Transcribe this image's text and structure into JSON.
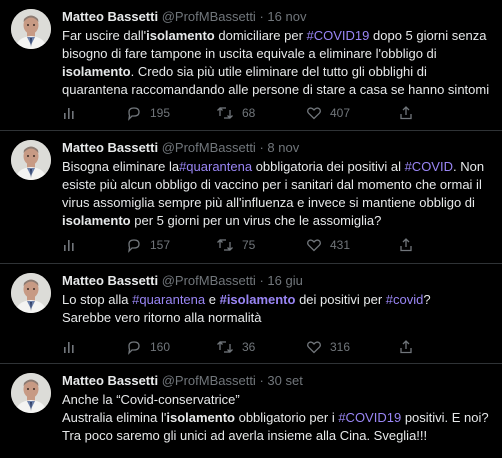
{
  "colors": {
    "background": "#000000",
    "text": "#e7e9ea",
    "muted": "#71767b",
    "hashtag": "#9a86f5",
    "divider": "#2f3336"
  },
  "tweets": [
    {
      "name": "Matteo Bassetti",
      "handle": "@ProfMBassetti",
      "sep": "·",
      "date": "16 nov",
      "parts": [
        {
          "t": "Far uscire dall'",
          "s": "text"
        },
        {
          "t": "isolamento",
          "s": "bold"
        },
        {
          "t": " domiciliare per ",
          "s": "text"
        },
        {
          "t": "#COVID19",
          "s": "tag"
        },
        {
          "t": " dopo 5 giorni senza bisogno di fare tampone in uscita equivale a eliminare l'obbligo di ",
          "s": "text"
        },
        {
          "t": "isolamento",
          "s": "bold"
        },
        {
          "t": ". Credo sia più utile eliminare del tutto gli obblighi di quarantena raccomandando alle persone di stare a casa se hanno sintomi",
          "s": "text"
        }
      ],
      "stats": {
        "views": "",
        "replies": "195",
        "retweets": "68",
        "likes": "407"
      }
    },
    {
      "name": "Matteo Bassetti",
      "handle": "@ProfMBassetti",
      "sep": "·",
      "date": "8 nov",
      "parts": [
        {
          "t": "Bisogna eliminare la",
          "s": "text"
        },
        {
          "t": "#quarantena",
          "s": "tag"
        },
        {
          "t": " obbligatoria dei positivi al ",
          "s": "text"
        },
        {
          "t": "#COVID",
          "s": "tag"
        },
        {
          "t": ". Non esiste più alcun obbligo di vaccino per i sanitari dal momento che ormai il virus assomiglia sempre più all'influenza e invece si mantiene obbligo di ",
          "s": "text"
        },
        {
          "t": "isolamento",
          "s": "bold"
        },
        {
          "t": " per 5 giorni per un virus che le assomiglia?",
          "s": "text"
        }
      ],
      "stats": {
        "views": "",
        "replies": "157",
        "retweets": "75",
        "likes": "431"
      }
    },
    {
      "name": "Matteo Bassetti",
      "handle": "@ProfMBassetti",
      "sep": "·",
      "date": "16 giu",
      "parts": [
        {
          "t": "Lo stop alla ",
          "s": "text"
        },
        {
          "t": "#quarantena",
          "s": "tag"
        },
        {
          "t": " e ",
          "s": "text"
        },
        {
          "t": "#isolamento",
          "s": "tagbold"
        },
        {
          "t": " dei positivi per ",
          "s": "text"
        },
        {
          "t": "#covid",
          "s": "tag"
        },
        {
          "t": "?",
          "s": "text"
        },
        {
          "t": "\n",
          "s": "br"
        },
        {
          "t": "Sarebbe vero ritorno alla normalità",
          "s": "text"
        }
      ],
      "stats": {
        "views": "",
        "replies": "160",
        "retweets": "36",
        "likes": "316"
      }
    },
    {
      "name": "Matteo Bassetti",
      "handle": "@ProfMBassetti",
      "sep": "·",
      "date": "30 set",
      "parts": [
        {
          "t": "Anche la “Covid-conservatrice”",
          "s": "text"
        },
        {
          "t": "\n",
          "s": "br"
        },
        {
          "t": "Australia elimina l'",
          "s": "text"
        },
        {
          "t": "isolamento",
          "s": "bold"
        },
        {
          "t": " obbligatorio per i ",
          "s": "text"
        },
        {
          "t": "#COVID19",
          "s": "tag"
        },
        {
          "t": " positivi. E noi? Tra poco saremo gli unici ad averla insieme alla Cina. Sveglia!!!",
          "s": "text"
        }
      ],
      "stats": null
    }
  ],
  "sticker": {
    "text": ""
  }
}
